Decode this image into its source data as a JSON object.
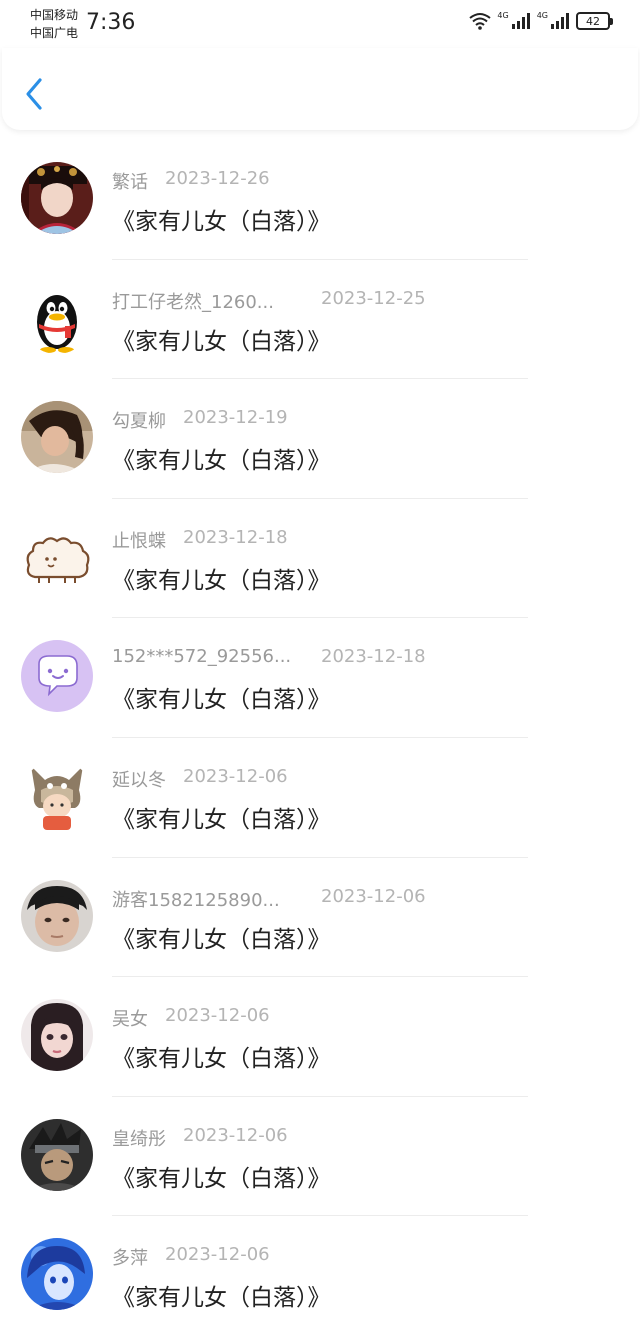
{
  "status_bar": {
    "carrier_1": "中国移动",
    "carrier_2": "中国广电",
    "time": "7:36",
    "network_1": "4G",
    "network_2": "4G",
    "battery": "42"
  },
  "nav": {
    "back_icon": "chevron-left-icon"
  },
  "items": [
    {
      "username": "繁话",
      "date": "2023-12-26",
      "title": "《家有儿女（白落）》",
      "avatar": "palace-lady"
    },
    {
      "username": "打工仔老然_1260...",
      "date": "2023-12-25",
      "title": "《家有儿女（白落）》",
      "avatar": "qq-penguin"
    },
    {
      "username": "勾夏柳",
      "date": "2023-12-19",
      "title": "《家有儿女（白落）》",
      "avatar": "girl-photo"
    },
    {
      "username": "止恨蝶",
      "date": "2023-12-18",
      "title": "《家有儿女（白落）》",
      "avatar": "sketch-sheep"
    },
    {
      "username": "152***572_92556...",
      "date": "2023-12-18",
      "title": "《家有儿女（白落）》",
      "avatar": "purple-chat"
    },
    {
      "username": "延以冬",
      "date": "2023-12-06",
      "title": "《家有儿女（白落）》",
      "avatar": "cartoon-totoro-kid"
    },
    {
      "username": "游客1582125890...",
      "date": "2023-12-06",
      "title": "《家有儿女（白落）》",
      "avatar": "boy-photo"
    },
    {
      "username": "吴女",
      "date": "2023-12-06",
      "title": "《家有儿女（白落）》",
      "avatar": "girl-selfie"
    },
    {
      "username": "皇绮彤",
      "date": "2023-12-06",
      "title": "《家有儿女（白落）》",
      "avatar": "anime-ninja"
    },
    {
      "username": "多萍",
      "date": "2023-12-06",
      "title": "《家有儿女（白落）》",
      "avatar": "anime-blue"
    }
  ],
  "colors": {
    "accent": "#2b8fe6",
    "meta_text": "#9a9a9a",
    "title_text": "#222222"
  }
}
